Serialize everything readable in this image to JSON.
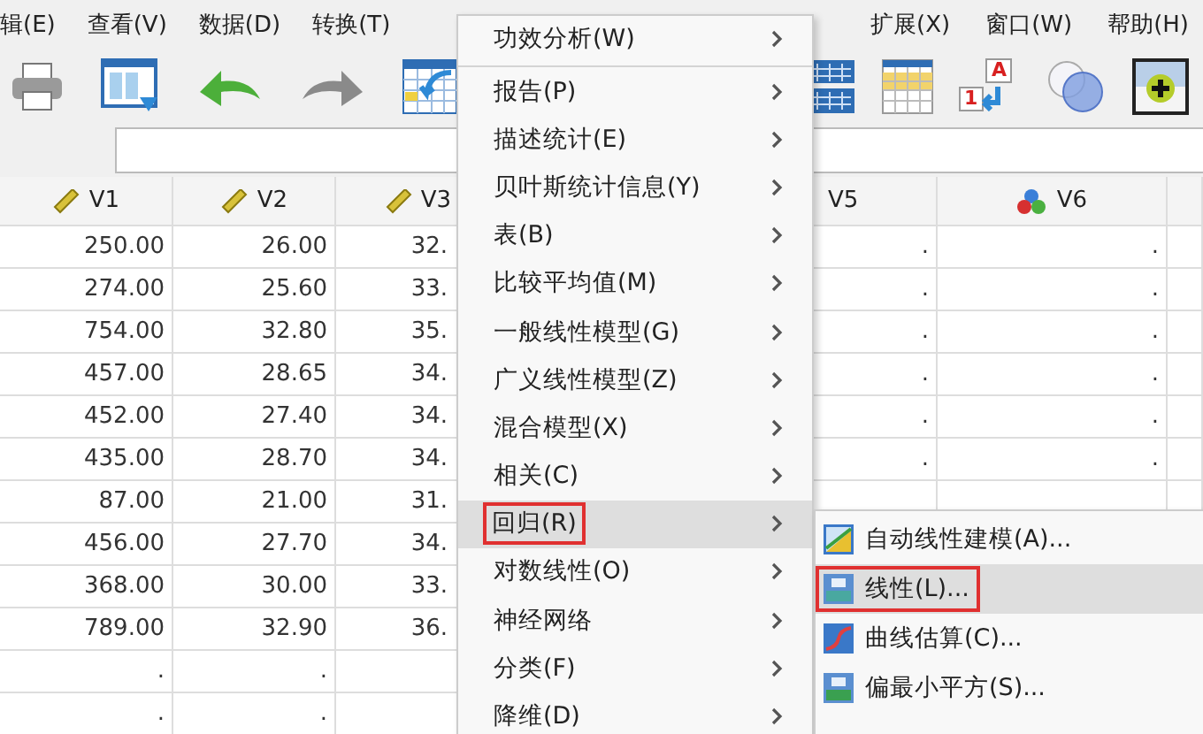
{
  "menubar": {
    "left": [
      {
        "label": "辑(E)"
      },
      {
        "label": "查看(V)"
      },
      {
        "label": "数据(D)"
      },
      {
        "label": "转换(T)"
      }
    ],
    "right": [
      {
        "label": "扩展(X)"
      },
      {
        "label": "窗口(W)"
      },
      {
        "label": "帮助(H)"
      }
    ]
  },
  "toolbar": {
    "left": [
      {
        "kind": "print"
      },
      {
        "kind": "data-view"
      },
      {
        "kind": "undo"
      },
      {
        "kind": "redo"
      },
      {
        "kind": "goto"
      }
    ],
    "right": [
      {
        "kind": "split"
      },
      {
        "kind": "select-cases"
      },
      {
        "kind": "value-labels",
        "glyphs": [
          "A",
          "1"
        ]
      },
      {
        "kind": "sets"
      },
      {
        "kind": "custom"
      }
    ]
  },
  "table": {
    "columns": [
      {
        "name": "V1",
        "kind": "scale"
      },
      {
        "name": "V2",
        "kind": "scale"
      },
      {
        "name": "V3",
        "kind": "scale"
      },
      {
        "name": "V5",
        "kind": "unknown"
      },
      {
        "name": "V6",
        "kind": "nominal"
      }
    ],
    "rows": [
      {
        "cells": [
          "250.00",
          "26.00",
          "32.",
          ".",
          "."
        ]
      },
      {
        "cells": [
          "274.00",
          "25.60",
          "33.",
          ".",
          "."
        ]
      },
      {
        "cells": [
          "754.00",
          "32.80",
          "35.",
          ".",
          "."
        ]
      },
      {
        "cells": [
          "457.00",
          "28.65",
          "34.",
          ".",
          "."
        ]
      },
      {
        "cells": [
          "452.00",
          "27.40",
          "34.",
          ".",
          "."
        ]
      },
      {
        "cells": [
          "435.00",
          "28.70",
          "34.",
          ".",
          "."
        ]
      },
      {
        "cells": [
          "87.00",
          "21.00",
          "31."
        ]
      },
      {
        "cells": [
          "456.00",
          "27.70",
          "34."
        ]
      },
      {
        "cells": [
          "368.00",
          "30.00",
          "33."
        ]
      },
      {
        "cells": [
          "789.00",
          "32.90",
          "36."
        ]
      },
      {
        "cells": [
          ".",
          "."
        ]
      },
      {
        "cells": [
          ".",
          "."
        ]
      }
    ]
  },
  "menu": {
    "items": [
      {
        "label": "功效分析(W)",
        "submenu": true,
        "selected": false,
        "boxed": false,
        "separator_after": true
      },
      {
        "label": "报告(P)",
        "submenu": true,
        "selected": false,
        "boxed": false
      },
      {
        "label": "描述统计(E)",
        "submenu": true,
        "selected": false,
        "boxed": false
      },
      {
        "label": "贝叶斯统计信息(Y)",
        "submenu": true,
        "selected": false,
        "boxed": false
      },
      {
        "label": "表(B)",
        "submenu": true,
        "selected": false,
        "boxed": false
      },
      {
        "label": "比较平均值(M)",
        "submenu": true,
        "selected": false,
        "boxed": false
      },
      {
        "label": "一般线性模型(G)",
        "submenu": true,
        "selected": false,
        "boxed": false
      },
      {
        "label": "广义线性模型(Z)",
        "submenu": true,
        "selected": false,
        "boxed": false
      },
      {
        "label": "混合模型(X)",
        "submenu": true,
        "selected": false,
        "boxed": false
      },
      {
        "label": "相关(C)",
        "submenu": true,
        "selected": false,
        "boxed": false
      },
      {
        "label": "回归(R)",
        "submenu": true,
        "selected": true,
        "boxed": true
      },
      {
        "label": "对数线性(O)",
        "submenu": true,
        "selected": false,
        "boxed": false
      },
      {
        "label": "神经网络",
        "submenu": true,
        "selected": false,
        "boxed": false
      },
      {
        "label": "分类(F)",
        "submenu": true,
        "selected": false,
        "boxed": false
      },
      {
        "label": "降维(D)",
        "submenu": true,
        "selected": false,
        "boxed": false
      }
    ]
  },
  "submenu": {
    "items": [
      {
        "label": "自动线性建模(A)...",
        "kind": "auto-linear",
        "selected": false,
        "boxed": false
      },
      {
        "label": "线性(L)...",
        "kind": "linear",
        "selected": true,
        "boxed": true
      },
      {
        "label": "曲线估算(C)...",
        "kind": "curve",
        "selected": false,
        "boxed": false
      },
      {
        "label": "偏最小平方(S)...",
        "kind": "pls",
        "selected": false,
        "boxed": false
      }
    ]
  }
}
